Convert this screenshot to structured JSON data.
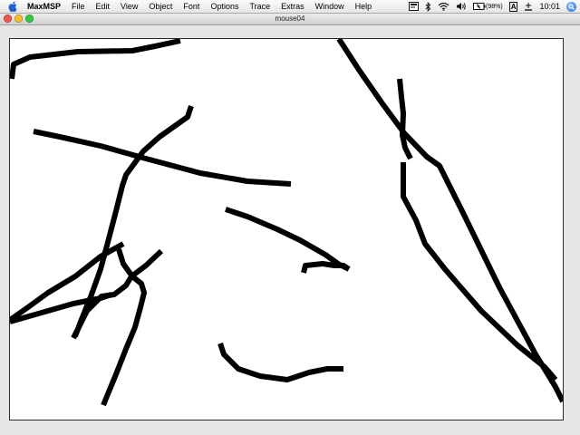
{
  "menubar": {
    "app_name": "MaxMSP",
    "items": [
      "File",
      "Edit",
      "View",
      "Object",
      "Font",
      "Options",
      "Trace",
      "Extras",
      "Window",
      "Help"
    ],
    "battery_text": "(98%)",
    "input_menu": "A",
    "clock": "10:01"
  },
  "window": {
    "title": "mouse04"
  },
  "colors": {
    "close": "#f0564d",
    "minimize": "#f7bc2e",
    "zoom": "#36c63f",
    "stroke": "#000000",
    "canvas": "#ffffff"
  },
  "icons": [
    "apple-icon",
    "script-menu-icon",
    "bluetooth-icon",
    "wifi-icon",
    "volume-icon",
    "battery-icon",
    "input-menu-icon",
    "sync-icon",
    "spotlight-icon"
  ]
}
